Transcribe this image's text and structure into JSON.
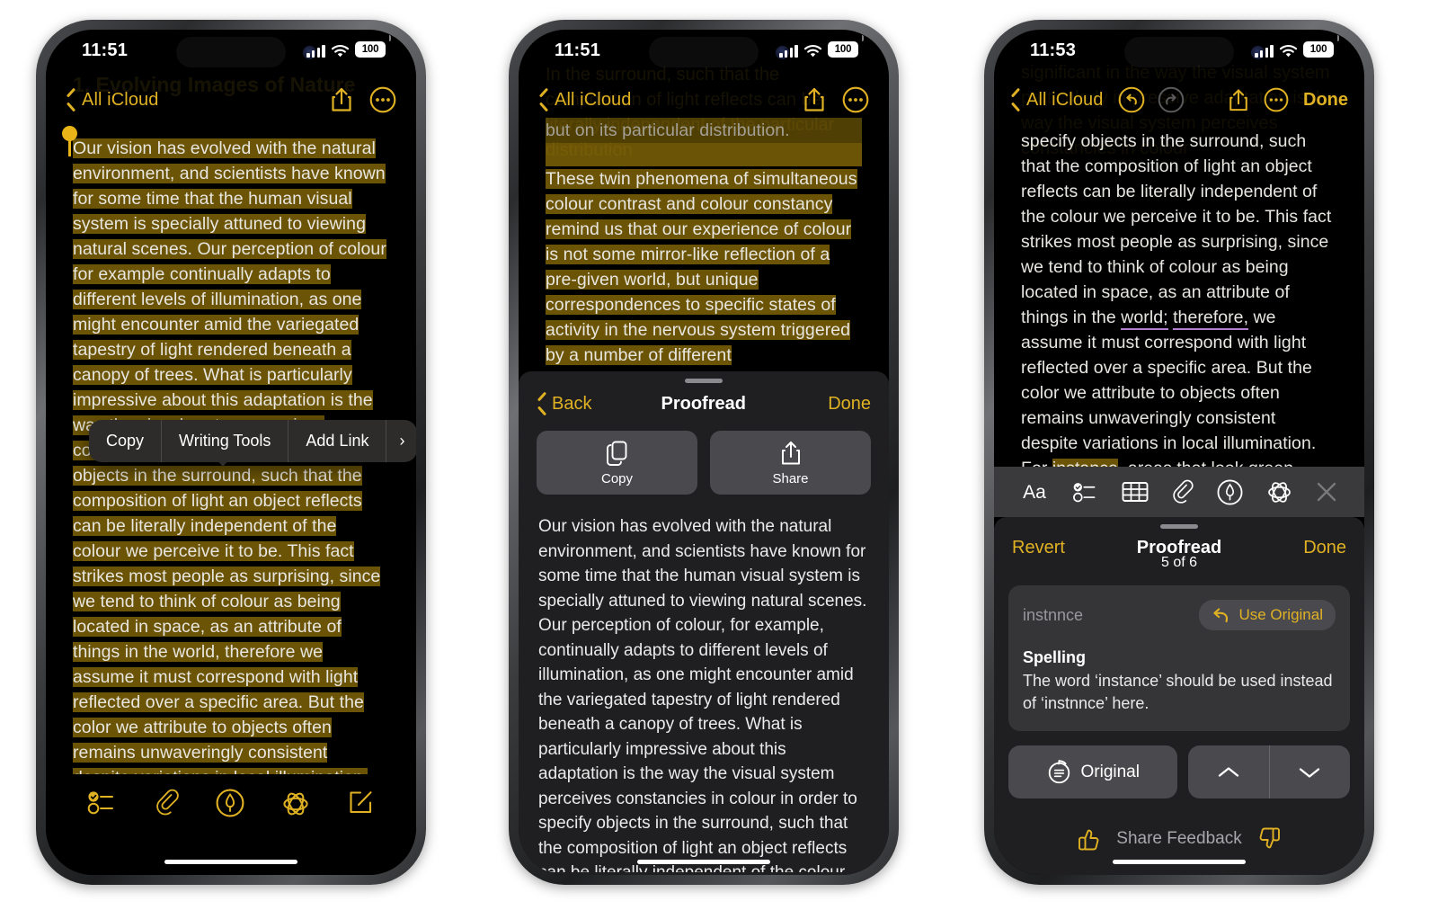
{
  "phones": [
    {
      "id": "phone-1",
      "status": {
        "time": "11:51",
        "battery": "100"
      },
      "nav": {
        "back_label": "All iCloud"
      },
      "ghost_title": "1. Evolving Images of Nature",
      "note_text": "Our vision has evolved with the natural environment, and scientists have known for some time that the human visual system is specially attuned to viewing natural scenes. Our perception of colour for example continually adapts to different levels of illumination, as one might encounter amid the variegated tapestry of light rendered beneath a canopy of trees. What is particularly impressive about this adaptation is the way the visual system perceives constancies in colour in order to specify objects in the surround, such that the composition of light an object reflects can be literally independent of the colour we perceive it to be. This fact strikes most people as surprising, since we tend to think of colour as being located in space, as an attribute of things in the world, therefore we assume it must correspond with light reflected over a specific area. But the color we attribute to objects often remains unwaveringly consistent despite variations in local illumination. For instance, areas that look green typically reflect a high level of",
      "context_menu": [
        "Copy",
        "Writing Tools",
        "Add Link"
      ],
      "context_menu_more": "›",
      "toolbar_icons": [
        "checklist-icon",
        "attachment-icon",
        "markup-icon",
        "apple-intelligence-icon",
        "compose-icon"
      ]
    },
    {
      "id": "phone-2",
      "status": {
        "time": "11:51",
        "battery": "100"
      },
      "nav": {
        "back_label": "All iCloud"
      },
      "note_partial_top": "but on its particular distribution.",
      "note_partial_body": "These twin phenomena of simultaneous colour contrast and colour constancy remind us that our experience of colour is not some mirror-like reflection of a pre-given world, but unique correspondences to specific states of activity in the nervous system triggered by a number of different",
      "sheet": {
        "back_label": "Back",
        "title": "Proofread",
        "done_label": "Done",
        "actions": [
          {
            "label": "Copy",
            "icon": "copy-icon"
          },
          {
            "label": "Share",
            "icon": "share-icon"
          }
        ],
        "body": "Our vision has evolved with the natural environment, and scientists have known for some time that the human visual system is specially attuned to viewing natural scenes. Our perception of colour, for example, continually adapts to different levels of illumination, as one might encounter amid the variegated tapestry of light rendered beneath a canopy of trees. What is particularly impressive about this adaptation is the way the visual system perceives constancies in colour in order to specify objects in the surround, such that the composition of light an object reflects can be literally independent of the colour we perceive it to be. This fact strikes most people as surprising, since we"
      }
    },
    {
      "id": "phone-3",
      "status": {
        "time": "11:53",
        "battery": "100"
      },
      "nav": {
        "back_label": "All iCloud",
        "done_label": "Done"
      },
      "note_segments": [
        {
          "text": "specify objects in the surround, such that the composition of light an object reflects can be literally independent of the colour we perceive it to be. This fact strikes most people as surprising, since we tend to think of colour as being located in space, as an attribute of things in the ",
          "style": "plain"
        },
        {
          "text": "world;",
          "style": "underline-purple"
        },
        {
          "text": " ",
          "style": "plain"
        },
        {
          "text": "therefore,",
          "style": "underline-purple"
        },
        {
          "text": " we assume it must correspond with light reflected over a specific area. But the color we attribute to objects often remains unwaveringly consistent despite variations in local illumination. For ",
          "style": "plain"
        },
        {
          "text": "instance",
          "style": "highlight-underline"
        },
        {
          "text": ", areas that look green typically reflect a high level of",
          "style": "plain"
        }
      ],
      "edit_strip_icons": [
        "format-aa-icon",
        "checklist-icon",
        "table-icon",
        "attachment-icon",
        "markup-icon",
        "apple-intelligence-icon",
        "close-icon"
      ],
      "sheet": {
        "revert_label": "Revert",
        "title": "Proofread",
        "done_label": "Done",
        "counter": "5 of 6",
        "card": {
          "original_word": "instnnce",
          "use_original_label": "Use Original",
          "kind": "Spelling",
          "description": "The word ‘instance’ should be used instead of ‘instnnce’ here."
        },
        "controls": {
          "original_label": "Original",
          "prev_icon": "chevron-up-icon",
          "next_icon": "chevron-down-icon"
        },
        "feedback": {
          "label": "Share Feedback",
          "up_icon": "thumbs-up-icon",
          "down_icon": "thumbs-down-icon"
        }
      }
    }
  ],
  "colors": {
    "accent": "#e0b223",
    "highlight": "#6b5405",
    "underline": "#b07fd0",
    "sheet_bg": "#1f1f21",
    "card_bg": "#353538",
    "button_bg": "#4a4a4e"
  }
}
